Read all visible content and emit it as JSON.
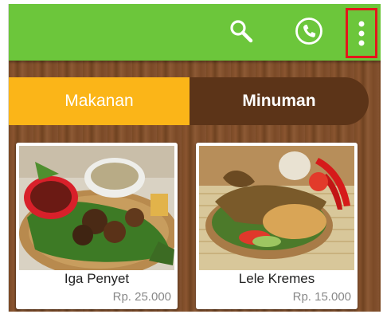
{
  "appbar": {
    "color": "#6cc63b",
    "icons": [
      "search-icon",
      "phone-icon",
      "more-vert-icon"
    ]
  },
  "tabs": [
    {
      "label": "Makanan",
      "selected": true,
      "color": "#fbb518"
    },
    {
      "label": "Minuman",
      "selected": false,
      "color": "#5c3418"
    }
  ],
  "menu": [
    {
      "name": "Iga Penyet",
      "price": "Rp. 25.000"
    },
    {
      "name": "Lele Kremes",
      "price": "Rp. 15.000"
    }
  ]
}
